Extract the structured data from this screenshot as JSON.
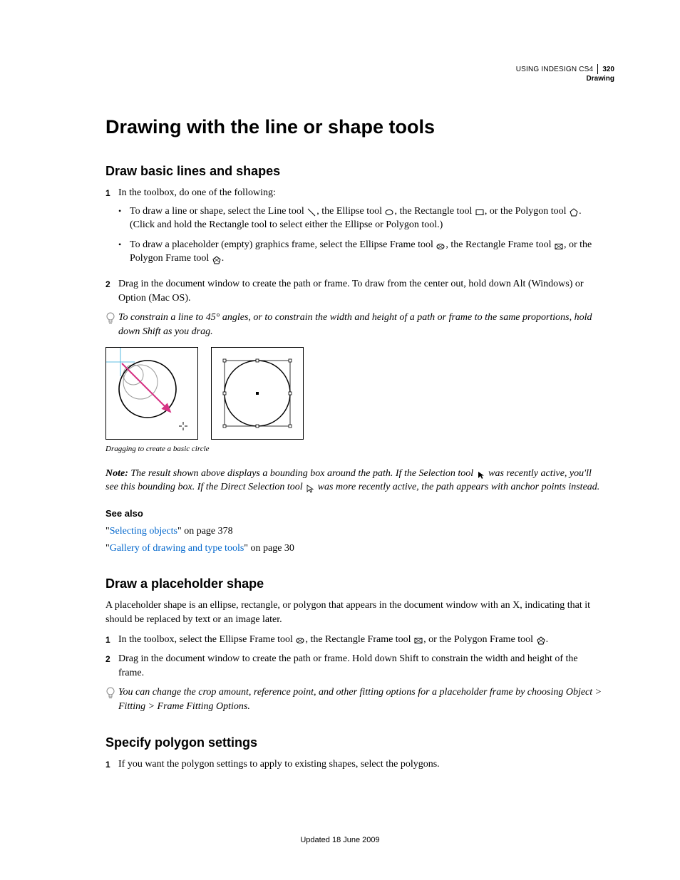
{
  "header": {
    "product": "USING INDESIGN CS4",
    "page_number": "320",
    "section": "Drawing"
  },
  "h1": "Drawing with the line or shape tools",
  "section1": {
    "heading": "Draw basic lines and shapes",
    "step1_num": "1",
    "step1": "In the toolbox, do one of the following:",
    "b1a_pre": "To draw a line or shape, select the Line tool ",
    "b1a_mid1": ", the Ellipse tool ",
    "b1a_mid2": ", the Rectangle tool ",
    "b1a_mid3": ", or the Polygon tool ",
    "b1a_post": ". (Click and hold the Rectangle tool to select either the Ellipse or Polygon tool.)",
    "b1b_pre": "To draw a placeholder (empty) graphics frame, select the Ellipse Frame tool ",
    "b1b_mid1": ", the Rectangle Frame tool ",
    "b1b_mid2": ", or the Polygon Frame tool ",
    "b1b_post": ".",
    "step2_num": "2",
    "step2": "Drag in the document window to create the path or frame. To draw from the center out, hold down Alt (Windows) or Option (Mac OS).",
    "tip": "To constrain a line to 45° angles, or to constrain the width and height of a path or frame to the same proportions, hold down Shift as you drag.",
    "caption": "Dragging to create a basic circle",
    "note_label": "Note: ",
    "note_pre": "The result shown above displays a bounding box around the path. If the Selection tool ",
    "note_mid": " was recently active, you'll see this bounding box. If the Direct Selection tool ",
    "note_post": " was more recently active, the path appears with anchor points instead.",
    "seealso_heading": "See also",
    "seealso1_link": "Selecting objects",
    "seealso1_rest": "\" on page 378",
    "seealso2_link": "Gallery of drawing and type tools",
    "seealso2_rest": "\" on page 30"
  },
  "section2": {
    "heading": "Draw a placeholder shape",
    "intro": "A placeholder shape is an ellipse, rectangle, or polygon that appears in the document window with an X, indicating that it should be replaced by text or an image later.",
    "step1_num": "1",
    "step1_pre": "In the toolbox, select the Ellipse Frame tool ",
    "step1_mid1": ", the Rectangle Frame tool ",
    "step1_mid2": ", or the Polygon Frame tool ",
    "step1_post": ".",
    "step2_num": "2",
    "step2": "Drag in the document window to create the path or frame. Hold down Shift to constrain the width and height of the frame.",
    "tip": "You can change the crop amount, reference point, and other fitting options for a placeholder frame by choosing Object > Fitting > Frame Fitting Options."
  },
  "section3": {
    "heading": "Specify polygon settings",
    "step1_num": "1",
    "step1": "If you want the polygon settings to apply to existing shapes, select the polygons."
  },
  "footer": "Updated 18 June 2009"
}
